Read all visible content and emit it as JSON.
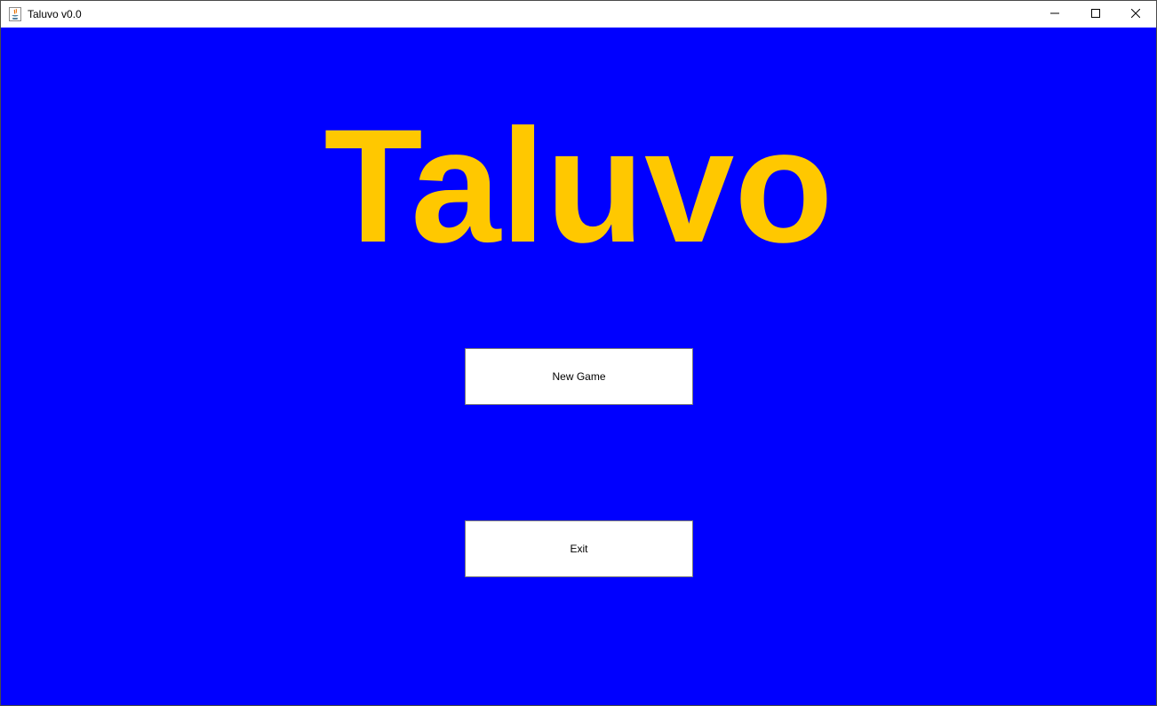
{
  "window": {
    "title": "Taluvo v0.0",
    "app_icon": "java-cup-icon",
    "controls": {
      "minimize_icon": "minimize-icon",
      "maximize_icon": "maximize-icon",
      "close_icon": "close-icon"
    }
  },
  "menu": {
    "game_title": "Taluvo",
    "new_game_label": "New Game",
    "exit_label": "Exit"
  },
  "colors": {
    "background": "#0000ff",
    "title_text": "#ffc800",
    "button_bg": "#ffffff"
  }
}
